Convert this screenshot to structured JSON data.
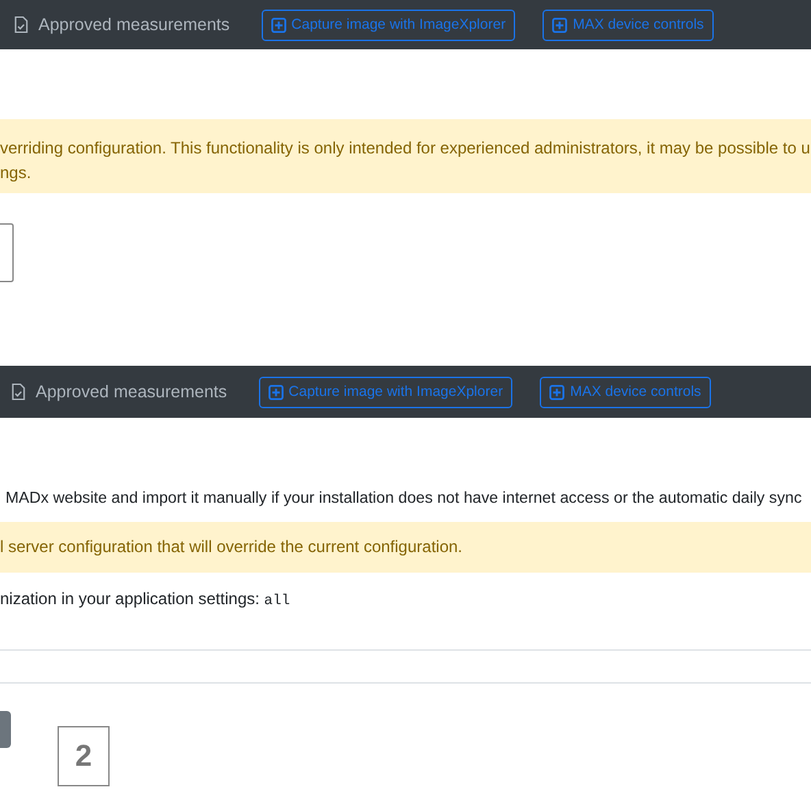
{
  "panels": [
    {
      "navbar": {
        "link": "Approved measurements",
        "buttons": [
          "Capture image with ImageXplorer",
          "MAX device controls"
        ]
      },
      "alert": {
        "lines": [
          "verriding configuration. This functionality is only intended for experienced administrators, it may be possible to u",
          "ngs."
        ]
      }
    },
    {
      "navbar": {
        "link": "Approved measurements",
        "buttons": [
          "Capture image with ImageXplorer",
          "MAX device controls"
        ]
      },
      "text": "MADx website and import it manually if your installation does not have internet access or the automatic daily sync",
      "alert": {
        "lines": [
          "l server configuration that will override the current configuration."
        ]
      },
      "setting": {
        "text": "nization in your application settings: ",
        "code": "all"
      },
      "step_number": "2"
    }
  ]
}
